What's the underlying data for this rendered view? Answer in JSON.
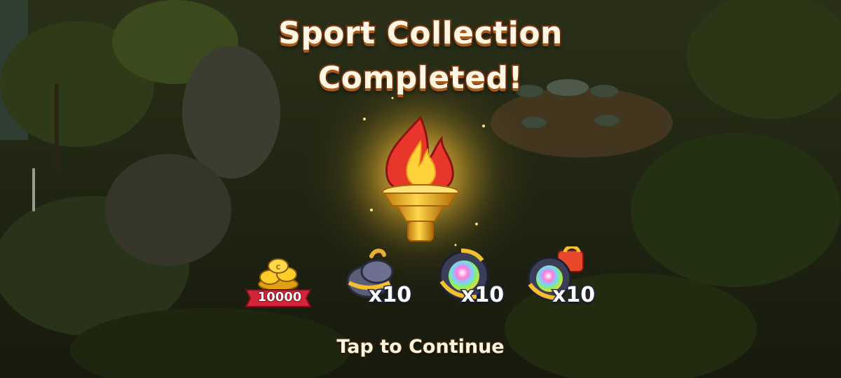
{
  "popup": {
    "title_line1": "Sport Collection",
    "title_line2": "Completed!",
    "prize_icon": "flaming-torch-icon",
    "continue_label": "Tap to Continue"
  },
  "rewards": [
    {
      "icon": "coin-pile-icon",
      "label": "10000"
    },
    {
      "icon": "bomb-icon",
      "label": "x10"
    },
    {
      "icon": "rainbow-orb-icon",
      "label": "x10"
    },
    {
      "icon": "rainbow-orb-rocket-icon",
      "label": "x10"
    }
  ],
  "colors": {
    "title_fill": "#fff6e4",
    "title_outline": "#7a3512",
    "flame_red": "#e8362a",
    "flame_yellow": "#ffd23a",
    "coin_ribbon": "#d3253a"
  }
}
